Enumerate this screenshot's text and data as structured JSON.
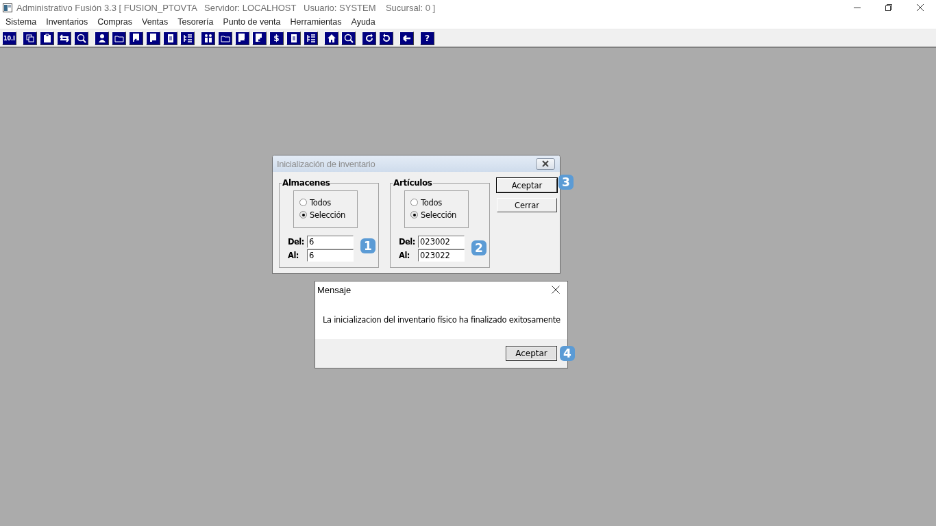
{
  "window": {
    "title": "Administrativo Fusión 3.3 [ FUSION_PTOVTA   Servidor: LOCALHOST   Usuario: SYSTEM    Sucursal: 0 ]"
  },
  "menu": [
    "Sistema",
    "Inventarios",
    "Compras",
    "Ventas",
    "Tesorería",
    "Punto de venta",
    "Herramientas",
    "Ayuda"
  ],
  "toolbar": [
    [
      {
        "kind": "text",
        "label": "10.I"
      }
    ],
    [
      {
        "kind": "copy"
      },
      {
        "kind": "clipboard"
      },
      {
        "kind": "swap"
      },
      {
        "kind": "zoom"
      }
    ],
    [
      {
        "kind": "person"
      },
      {
        "kind": "folder"
      },
      {
        "kind": "doc-left"
      },
      {
        "kind": "doc-minus"
      },
      {
        "kind": "doc"
      },
      {
        "kind": "tree"
      }
    ],
    [
      {
        "kind": "people"
      },
      {
        "kind": "folder"
      },
      {
        "kind": "doc-arrow"
      },
      {
        "kind": "doc-plus"
      },
      {
        "kind": "text",
        "label": "$"
      },
      {
        "kind": "doc"
      },
      {
        "kind": "tree"
      }
    ],
    [
      {
        "kind": "home"
      },
      {
        "kind": "zoom"
      }
    ],
    [
      {
        "kind": "refresh"
      },
      {
        "kind": "undo"
      }
    ],
    [
      {
        "kind": "arrow-left"
      }
    ],
    [
      {
        "kind": "text",
        "label": "?"
      }
    ]
  ],
  "dialog": {
    "title": "Inicialización de inventario",
    "groups": [
      {
        "title": "Almacenes",
        "options": [
          {
            "label": "Todos",
            "selected": false
          },
          {
            "label": "Selección",
            "selected": true
          }
        ],
        "fields": [
          {
            "label": "Del:",
            "value": "6"
          },
          {
            "label": "Al:",
            "value": "6"
          }
        ]
      },
      {
        "title": "Artículos",
        "options": [
          {
            "label": "Todos",
            "selected": false
          },
          {
            "label": "Selección",
            "selected": true
          }
        ],
        "fields": [
          {
            "label": "Del:",
            "value": "023002"
          },
          {
            "label": "Al:",
            "value": "023022"
          }
        ]
      }
    ],
    "buttons": [
      {
        "label": "Aceptar",
        "default": true
      },
      {
        "label": "Cerrar",
        "default": false
      }
    ]
  },
  "message": {
    "title": "Mensaje",
    "text": "La inicializacion del inventario físico ha finalizado exitosamente",
    "button": "Aceptar"
  },
  "annotations": [
    "1",
    "2",
    "3",
    "4"
  ]
}
